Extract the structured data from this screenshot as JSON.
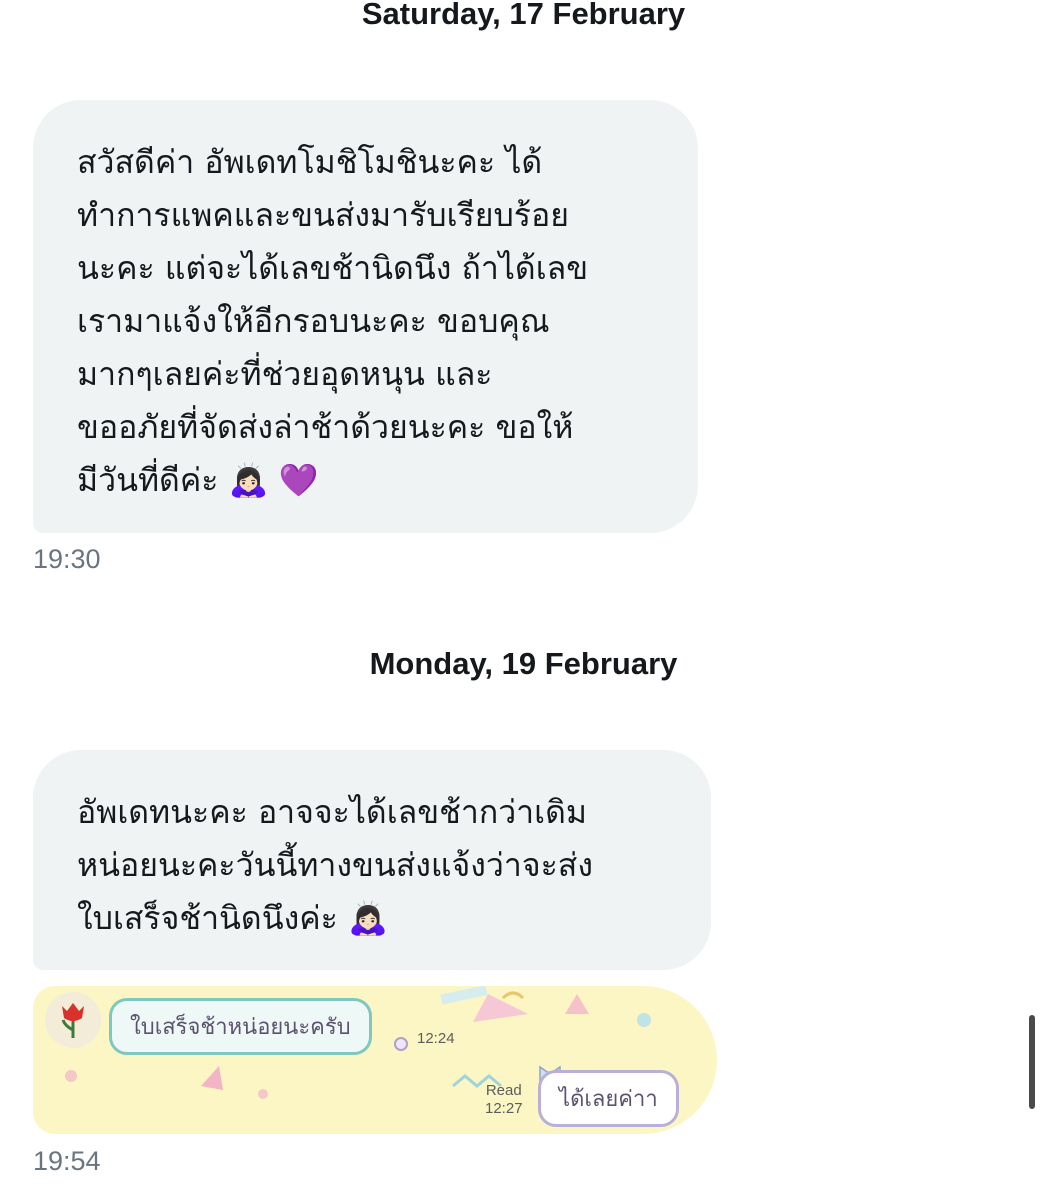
{
  "conversation": {
    "date_separators": [
      "Saturday, 17 February",
      "Monday, 19 February"
    ],
    "messages": [
      {
        "text": "สวัสดีค่า อัพเดทโมชิโมชินะคะ ได้\nทำการแพคและขนส่งมารับเรียบร้อย\nนะคะ แต่จะได้เลขช้านิดนึง ถ้าได้เลข\nเรามาแจ้งให้อีกรอบนะคะ ขอบคุณ\nมากๆเลยค่ะที่ช่วยอุดหนุน และ\nขออภัยที่จัดส่งล่าช้าด้วยนะคะ ขอให้\nมีวันที่ดีค่ะ",
        "emojis": "🙇🏻‍♀️ 💜",
        "time": "19:30"
      },
      {
        "text": "อัพเดทนะคะ อาจจะได้เลขช้ากว่าเดิม\nหน่อยนะคะวันนี้ทางขนส่งแจ้งว่าจะส่ง\nใบเสร็จช้านิดนึงค่ะ",
        "emojis": "🙇🏻‍♀️",
        "time": "19:54"
      }
    ],
    "attachment": {
      "incoming_text": "ใบเสร็จช้าหน่อยนะครับ",
      "incoming_time": "12:24",
      "read_label": "Read",
      "outgoing_time": "12:27",
      "outgoing_text": "ได้เลยค่าา",
      "avatar_icon": "rose-icon",
      "bow_icon": "ribbon-bow-icon"
    }
  },
  "colors": {
    "bubble_bg": "#eff3f4",
    "time_text": "#6a7580",
    "attachment_bg": "#fbf6c4"
  }
}
